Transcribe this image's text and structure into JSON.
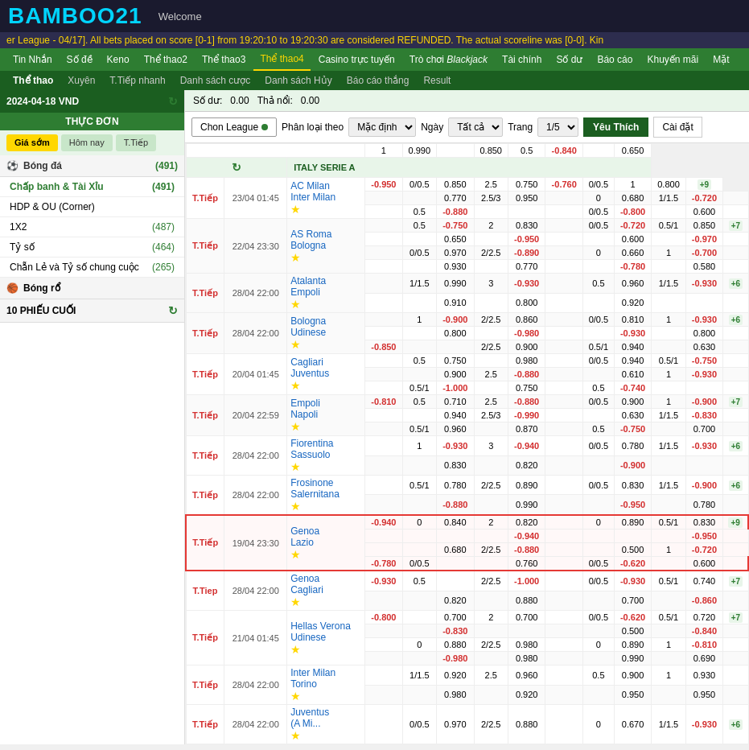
{
  "header": {
    "logo": "BAMBOO21",
    "welcome": "Welcome"
  },
  "marquee": "er League - 04/17]. All bets placed on score [0-1] from 19:20:10 to 19:20:30 are considered REFUNDED. The actual scoreline was [0-0]. Kin",
  "nav_top": [
    {
      "label": "Tin Nhắn",
      "active": false
    },
    {
      "label": "Số đề",
      "active": false
    },
    {
      "label": "Keno",
      "active": false
    },
    {
      "label": "Thể thao2",
      "active": false
    },
    {
      "label": "Thể thao3",
      "active": false
    },
    {
      "label": "Thể thao4",
      "active": true
    },
    {
      "label": "Casino trực tuyến",
      "active": false
    },
    {
      "label": "Trò chơi Blackjack",
      "active": false
    },
    {
      "label": "Tài chính",
      "active": false
    },
    {
      "label": "Số dư",
      "active": false
    },
    {
      "label": "Báo cáo",
      "active": false
    },
    {
      "label": "Khuyến mãi",
      "active": false
    },
    {
      "label": "Mặt",
      "active": false
    }
  ],
  "nav_sub": [
    {
      "label": "Thể thao",
      "active": true
    },
    {
      "label": "Xuyên",
      "active": false
    },
    {
      "label": "T.Tiếp nhanh",
      "active": false
    },
    {
      "label": "Danh sách cược",
      "active": false
    },
    {
      "label": "Danh sách Hủy",
      "active": false
    },
    {
      "label": "Báo cáo thắng",
      "active": false
    },
    {
      "label": "Result",
      "active": false
    }
  ],
  "sidebar": {
    "date": "2024-04-18 VND",
    "balance_label": "THỰC ĐƠN",
    "tabs": [
      "Giá sớm",
      "Hôm nay",
      "T.Tiếp"
    ],
    "active_tab": 0,
    "balance": {
      "so_du": "0.00",
      "tha_ne": "0.00"
    },
    "bong_da": {
      "label": "Bóng đá",
      "count": 491
    },
    "items": [
      {
        "label": "Chấp banh & Tài Xỉu",
        "count": 491,
        "active": true
      },
      {
        "label": "HDP & OU (Corner)",
        "count": null
      },
      {
        "label": "1X2",
        "count": 487
      },
      {
        "label": "Tỷ số",
        "count": 464
      },
      {
        "label": "Chẵn Lẻ và Tỷ số chung cuộc",
        "count": 265
      }
    ],
    "bong_ro": {
      "label": "Bóng rổ"
    },
    "phieu_cuoi": {
      "label": "10 PHIẾU CUỐI"
    }
  },
  "content": {
    "so_du_label": "Số dư:",
    "so_du_val": "0.00",
    "tha_ne_label": "Thả nổi:",
    "tha_ne_val": "0.00",
    "chon_league_btn": "Chon League",
    "phan_loai_theo_label": "Phân loại theo",
    "phan_loai_options": [
      "Mặc định"
    ],
    "phan_loai_selected": "Mặc định",
    "ngay_label": "Ngày",
    "ngay_options": [
      "Tất cả"
    ],
    "ngay_selected": "Tất cả",
    "trang_label": "Trang",
    "trang_value": "1/5",
    "yeu_thich_btn": "Yêu Thích",
    "cai_dat_btn": "Cài đặt"
  },
  "leagues": [
    {
      "name": "ITALY SERIE A",
      "matches": [
        {
          "status": "T.Tiếp",
          "date": "23/04 01:45",
          "team1": "AC Milan",
          "team2": "Inter Milan",
          "rows": [
            {
              "hdp": "0/0.5",
              "odds1": "0.850",
              "ou": "-0.950",
              "odds2": "2.5",
              "odds3": "0.750",
              "hdp2": "0/0.5",
              "odds4": "-0.760",
              "ou2": "1",
              "odds5": "0.800",
              "plus": "+9",
              "r1": "-0.950",
              "r2": "",
              "r3": "",
              "r4": "-0.760"
            },
            {
              "hdp": "",
              "odds1": "0.770",
              "ou": "",
              "odds2": "2.5/3",
              "odds3": "0.950",
              "hdp2": "0",
              "odds4": "0.680",
              "ou2": "1/1.5",
              "odds5": "-0.720"
            },
            {
              "hdp": "",
              "odds1": "0.5",
              "ou": "-0.880",
              "odds2": "",
              "odds3": "",
              "hdp2": "0/0.5",
              "odds4": "-0.800",
              "ou2": "",
              "odds5": "0.600"
            }
          ]
        },
        {
          "status": "T.Tiếp",
          "date": "22/04 23:30",
          "team1": "AS Roma",
          "team2": "Bologna",
          "plus": "+7",
          "rows": [
            {
              "r1": "-0.950",
              "hdp": "0.5",
              "odds1": "-0.750",
              "ou": "2",
              "odds2": "0.830",
              "hdp2": "0/0.5",
              "odds4": "-0.720",
              "ou2": "0.5/1",
              "odds5": "0.850"
            },
            {
              "hdp": "",
              "odds1": "0.650",
              "ou": "",
              "odds2": "-0.950",
              "hdp2": "",
              "odds4": "0.600",
              "ou2": "",
              "odds5": "-0.970"
            },
            {
              "hdp": "0/0.5",
              "odds1": "0.970",
              "ou": "2/2.5",
              "odds2": "-0.890",
              "hdp2": "0",
              "odds4": "0.660",
              "ou2": "1",
              "odds5": "-0.700"
            },
            {
              "hdp": "",
              "odds1": "0.930",
              "ou": "",
              "odds2": "0.770",
              "hdp2": "",
              "odds4": "-0.780",
              "ou2": "",
              "odds5": "0.580"
            }
          ]
        },
        {
          "status": "T.Tiếp",
          "date": "28/04 22:00",
          "team1": "Atalanta",
          "team2": "Empoli",
          "plus": "+6",
          "rows": [
            {
              "hdp": "1/1.5",
              "odds1": "0.990",
              "ou": "3",
              "odds2": "-0.930",
              "hdp2": "0.5",
              "odds4": "0.960",
              "ou2": "1/1.5",
              "odds5": "-0.930"
            },
            {
              "hdp": "",
              "odds1": "0.910",
              "ou": "",
              "odds2": "0.800",
              "hdp2": "",
              "odds4": "0.920",
              "ou2": "",
              "odds5": ""
            }
          ]
        },
        {
          "status": "T.Tiếp",
          "date": "28/04 22:00",
          "team1": "Bologna",
          "team2": "Udinese",
          "plus": "+6",
          "rows": [
            {
              "hdp": "1",
              "odds1": "-0.900",
              "ou": "2/2.5",
              "odds2": "0.860",
              "hdp2": "0/0.5",
              "odds4": "0.810",
              "ou2": "1",
              "odds5": "-0.930"
            },
            {
              "hdp": "",
              "odds1": "0.800",
              "ou": "",
              "odds2": "-0.980",
              "hdp2": "",
              "odds4": "-0.930",
              "ou2": "",
              "odds5": "0.800"
            },
            {
              "r1": "-0.850",
              "hdp": "",
              "odds1": "",
              "ou": "2/2.5",
              "odds2": "0.900",
              "hdp2": "0.5/1",
              "odds4": "0.940",
              "ou2": "",
              "odds5": "0.630"
            }
          ]
        },
        {
          "status": "T.Tiếp",
          "date": "20/04 01:45",
          "team1": "Cagliari",
          "team2": "Juventus",
          "rows": [
            {
              "hdp": "0.5",
              "odds1": "0.750",
              "ou": "",
              "odds2": "0.980",
              "hdp2": "0/0.5",
              "odds4": "0.940",
              "ou2": "0.5/1",
              "odds5": "-0.750"
            },
            {
              "hdp": "",
              "odds1": "0.900",
              "ou": "2.5",
              "odds2": "-0.880",
              "hdp2": "",
              "odds4": "0.610",
              "ou2": "1",
              "odds5": "-0.930"
            },
            {
              "hdp": "0.5/1",
              "odds1": "-1.000",
              "ou": "",
              "odds2": "0.750",
              "hdp2": "0.5",
              "odds4": "-0.740",
              "ou2": "",
              "odds5": ""
            }
          ]
        },
        {
          "status": "T.Tiếp",
          "date": "20/04 22:59",
          "team1": "Empoli",
          "team2": "Napoli",
          "plus": "+7",
          "rows": [
            {
              "r1": "-0.810",
              "hdp": "0.5",
              "odds1": "0.710",
              "ou": "2.5",
              "odds2": "-0.880",
              "hdp2": "0/0.5",
              "odds4": "0.900",
              "ou2": "1",
              "odds5": "-0.900"
            },
            {
              "hdp": "",
              "odds1": "0.940",
              "ou": "2.5/3",
              "odds2": "-0.990",
              "hdp2": "",
              "odds4": "0.630",
              "ou2": "1/1.5",
              "odds5": "-0.830"
            },
            {
              "hdp": "0.5/1",
              "odds1": "0.960",
              "ou": "",
              "odds2": "0.870",
              "hdp2": "0.5",
              "odds4": "-0.750",
              "ou2": "",
              "odds5": "0.700"
            }
          ]
        },
        {
          "status": "T.Tiếp",
          "date": "28/04 22:00",
          "team1": "Fiorentina",
          "team2": "Sassuolo",
          "plus": "+6",
          "rows": [
            {
              "hdp": "1",
              "odds1": "-0.930",
              "ou": "3",
              "odds2": "-0.940",
              "hdp2": "0/0.5",
              "odds4": "0.780",
              "ou2": "1/1.5",
              "odds5": "-0.930"
            },
            {
              "hdp": "",
              "odds1": "0.830",
              "ou": "",
              "odds2": "0.820",
              "hdp2": "",
              "odds4": "-0.900",
              "ou2": "",
              "odds5": ""
            }
          ]
        },
        {
          "status": "T.Tiếp",
          "date": "28/04 22:00",
          "team1": "Frosinone",
          "team2": "Salernitana",
          "plus": "+6",
          "rows": [
            {
              "hdp": "0.5/1",
              "odds1": "0.780",
              "ou": "2/2.5",
              "odds2": "0.890",
              "hdp2": "0/0.5",
              "odds4": "0.830",
              "ou2": "1/1.5",
              "odds5": "-0.900"
            },
            {
              "hdp": "",
              "odds1": "-0.880",
              "ou": "",
              "odds2": "0.990",
              "hdp2": "",
              "odds4": "-0.950",
              "ou2": "",
              "odds5": "0.780"
            }
          ]
        },
        {
          "status": "T.Tiếp",
          "date": "19/04 23:30",
          "team1": "Genoa",
          "team2": "Lazio",
          "plus": "+9",
          "highlighted": true,
          "rows": [
            {
              "r1": "-0.940",
              "hdp": "0",
              "odds1": "0.840",
              "ou": "2",
              "odds2": "0.820",
              "hdp2": "0",
              "odds4": "0.890",
              "ou2": "0.5/1",
              "odds5": "0.830"
            },
            {
              "r2": "",
              "hdp": "",
              "odds1": "",
              "ou": "",
              "odds2": "-0.940",
              "hdp2": "",
              "odds4": "",
              "ou2": "",
              "odds5": "-0.950"
            },
            {
              "hdp": "",
              "odds1": "0.680",
              "ou": "2/2.5",
              "odds2": "-0.880",
              "hdp2": "",
              "odds4": "0.500",
              "ou2": "1",
              "odds5": "-0.720"
            },
            {
              "r3": "-0.780",
              "hdp": "0/0.5",
              "odds1": "",
              "ou": "",
              "odds2": "0.760",
              "hdp2": "0/0.5",
              "odds4": "-0.620",
              "ou2": "",
              "odds5": "0.600"
            }
          ]
        },
        {
          "status": "T.Tiep",
          "date": "28/04 22:00",
          "team1": "Genoa",
          "team2": "Cagliari",
          "plus": "+7",
          "rows": [
            {
              "r1": "-0.930",
              "hdp": "0.5",
              "odds1": "",
              "ou": "2/2.5",
              "odds2": "-1.000",
              "hdp2": "0/0.5",
              "odds4": "-0.930",
              "ou2": "0.5/1",
              "odds5": "0.740"
            },
            {
              "hdp": "",
              "odds1": "0.820",
              "ou": "",
              "odds2": "0.880",
              "hdp2": "",
              "odds4": "0.700",
              "ou2": "",
              "odds5": "-0.860"
            }
          ]
        },
        {
          "status": "T.Tiếp",
          "date": "21/04 01:45",
          "team1": "Hellas Verona",
          "team2": "Udinese",
          "plus": "+7",
          "rows": [
            {
              "r1": "-0.800",
              "hdp": "",
              "odds1": "0.700",
              "ou": "2",
              "odds2": "0.700",
              "hdp2": "0/0.5",
              "odds4": "-0.620",
              "ou2": "0.5/1",
              "odds5": "0.720"
            },
            {
              "hdp": "",
              "odds1": "-0.830",
              "ou": "",
              "odds2": "",
              "hdp2": "",
              "odds4": "0.500",
              "ou2": "",
              "odds5": "-0.840"
            },
            {
              "hdp": "0",
              "odds1": "0.880",
              "ou": "2/2.5",
              "odds2": "0.980",
              "hdp2": "0",
              "odds4": "0.890",
              "ou2": "1",
              "odds5": "-0.810"
            },
            {
              "hdp": "",
              "odds1": "-0.980",
              "ou": "",
              "odds2": "0.980",
              "hdp2": "",
              "odds4": "0.990",
              "ou2": "",
              "odds5": "0.690"
            }
          ]
        },
        {
          "status": "T.Tiếp",
          "date": "28/04 22:00",
          "team1": "Inter Milan",
          "team2": "Torino",
          "rows": [
            {
              "hdp": "1/1.5",
              "odds1": "0.920",
              "ou": "2.5",
              "odds2": "0.960",
              "hdp2": "0.5",
              "odds4": "0.900",
              "ou2": "1",
              "odds5": "0.930"
            },
            {
              "hdp": "",
              "odds1": "0.980",
              "ou": "",
              "odds2": "0.920",
              "hdp2": "",
              "odds4": "0.950",
              "ou2": "",
              "odds5": "0.950"
            }
          ]
        },
        {
          "status": "T.Tiếp",
          "date": "28/04 22:00",
          "team1": "Juventus",
          "team2": "(A Mi...",
          "plus": "+6",
          "rows": [
            {
              "hdp": "0/0.5",
              "odds1": "0.970",
              "ou": "2/2.5",
              "odds2": "0.880",
              "hdp2": "0",
              "odds4": "0.670",
              "ou2": "1/1.5",
              "odds5": "-0.930"
            }
          ]
        }
      ]
    }
  ]
}
